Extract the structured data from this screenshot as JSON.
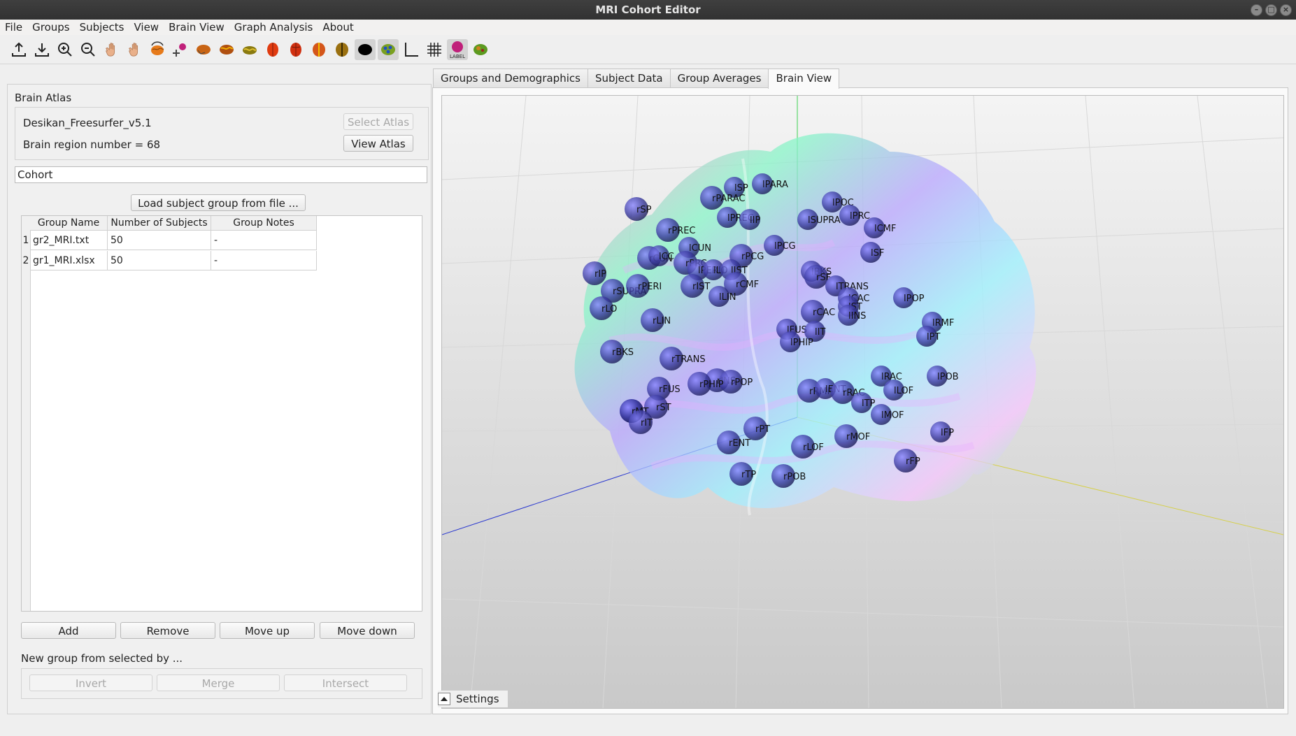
{
  "window": {
    "title": "MRI Cohort Editor"
  },
  "menu": [
    "File",
    "Groups",
    "Subjects",
    "View",
    "Brain View",
    "Graph Analysis",
    "About"
  ],
  "toolbar": {
    "icons": [
      "upload-icon",
      "download-icon",
      "zoom-in-icon",
      "zoom-out-icon",
      "hand-icon",
      "pan-hand-icon",
      "brain-rotate-icon",
      "split-view-icon",
      "brain-lateral-icon",
      "brain-medial-icon",
      "brain-top-icon",
      "brain-front-icon",
      "brain-back-icon",
      "brain-left-icon",
      "brain-right-icon",
      "brain-black-icon",
      "brain-color-icon",
      "axes-icon",
      "grid-icon",
      "label-icon",
      "brain-small-icon"
    ],
    "label_icon_text": "LABEL"
  },
  "left": {
    "atlas_title": "Brain Atlas",
    "atlas_name": "Desikan_Freesurfer_v5.1",
    "region_number": "Brain region number = 68",
    "select_atlas": "Select Atlas",
    "view_atlas": "View Atlas",
    "cohort": "Cohort",
    "load_group": "Load subject group from file ...",
    "table": {
      "headers": [
        "Group Name",
        "Number of Subjects",
        "Group Notes"
      ],
      "rows": [
        {
          "n": "1",
          "name": "gr2_MRI.txt",
          "subjects": "50",
          "notes": "-"
        },
        {
          "n": "2",
          "name": "gr1_MRI.xlsx",
          "subjects": "50",
          "notes": "-"
        }
      ]
    },
    "buttons": {
      "add": "Add",
      "remove": "Remove",
      "move_up": "Move up",
      "move_down": "Move down"
    },
    "new_group_label": "New group from selected by ...",
    "set_ops": {
      "invert": "Invert",
      "merge": "Merge",
      "intersect": "Intersect"
    }
  },
  "tabs": [
    "Groups and Demographics",
    "Subject Data",
    "Group Averages",
    "Brain View"
  ],
  "active_tab": "Brain View",
  "brain_view": {
    "settings_label": "Settings",
    "labels": [
      "lSP",
      "lPARA",
      "rPARAC",
      "rSP",
      "lPOC",
      "lSUPRA",
      "lPRC",
      "lPREC",
      "lIP",
      "lCMF",
      "rPREC",
      "lCUN",
      "lPCG",
      "rPCG",
      "rCUN",
      "lCC",
      "lSF",
      "rIP",
      "rPRC",
      "lPERI",
      "lLO",
      "lIST",
      "lBKS",
      "rSF",
      "rSUPRA",
      "rPERI",
      "rIST",
      "rCMF",
      "lTRANS",
      "rLO",
      "lLIN",
      "lCAC",
      "lST",
      "rCAC",
      "rMT",
      "lINS",
      "lPOP",
      "rLIN",
      "lRMF",
      "lFUS",
      "lIT",
      "lPHIP",
      "lPT",
      "rBKS",
      "rTRANS",
      "lPOB",
      "rINS",
      "rPOP",
      "lRAC",
      "rPHIP",
      "lLOF",
      "rFUS",
      "rRMF",
      "lENT",
      "rRAC",
      "lTP",
      "rST",
      "rMT",
      "lMOF",
      "rIT",
      "rPT",
      "lFP",
      "rENT",
      "rMOF",
      "rLOF",
      "rFP",
      "rTP",
      "rPOB"
    ]
  }
}
